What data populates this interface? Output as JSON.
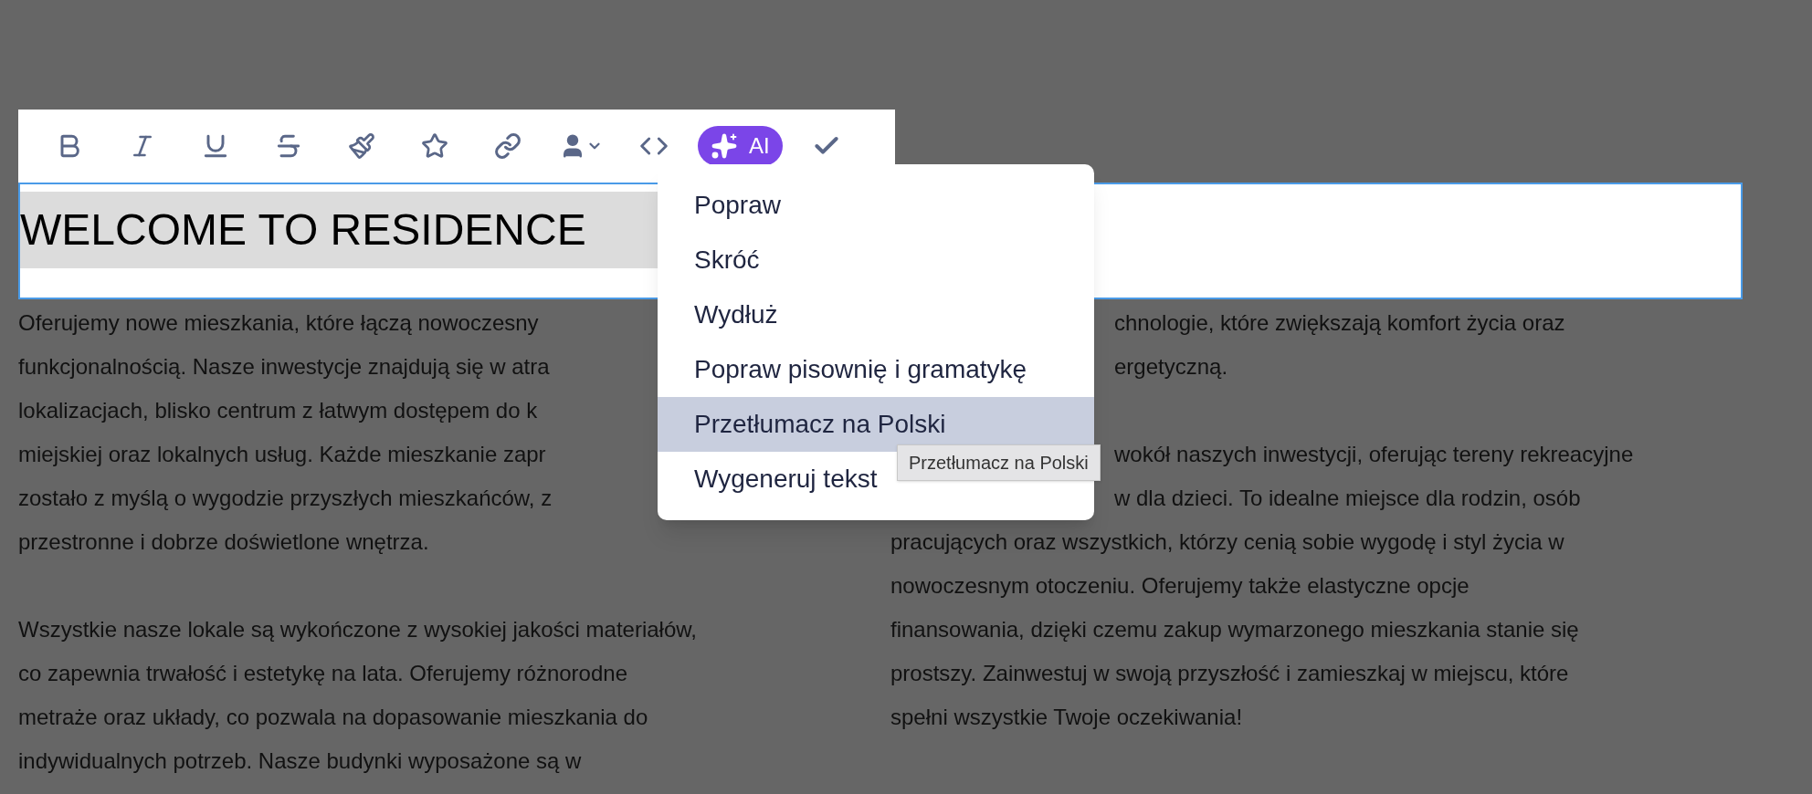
{
  "toolbar": {
    "ai_button": {
      "label": "AI"
    }
  },
  "heading": {
    "text": "WELCOME TO RESIDENCE",
    "highlighted": true
  },
  "left_column": {
    "paragraphs": [
      [
        "Oferujemy nowe mieszkania, które łączą nowoczesny",
        "funkcjonalnością. Nasze inwestycje znajdują się w atra",
        "lokalizacjach, blisko centrum z łatwym dostępem do k",
        "miejskiej oraz lokalnych usług. Każde mieszkanie zapr",
        "zostało z myślą o wygodzie przyszłych mieszkańców, z",
        "przestronne i dobrze doświetlone wnętrza."
      ],
      [
        "Wszystkie nasze lokale są wykończone z wysokiej jakości materiałów,",
        "co zapewnia trwałość i estetykę na lata. Oferujemy różnorodne",
        "metraże oraz układy, co pozwala na dopasowanie mieszkania do",
        "indywidualnych potrzeb. Nasze budynki wyposażone są w"
      ]
    ]
  },
  "right_column": {
    "paragraphs": [
      {
        "beside_menu": [
          "chnologie, które zwiększają komfort życia oraz",
          "ergetyczną."
        ]
      },
      {
        "beside_menu": [
          "wokół naszych inwestycji, oferując tereny rekreacyjne",
          "w dla dzieci. To idealne miejsce dla rodzin, osób"
        ],
        "lines": [
          "pracujących oraz wszystkich, którzy cenią sobie wygodę i styl życia w",
          "nowoczesnym otoczeniu. Oferujemy także elastyczne opcje",
          "finansowania, dzięki czemu zakup wymarzonego mieszkania stanie się",
          "prostszy. Zainwestuj w swoją przyszłość i zamieszkaj w miejscu, które",
          "spełni wszystkie Twoje oczekiwania!"
        ]
      }
    ]
  },
  "ai_menu": {
    "items": [
      {
        "label": "Popraw",
        "selected": false
      },
      {
        "label": "Skróć",
        "selected": false
      },
      {
        "label": "Wydłuż",
        "selected": false
      },
      {
        "label": "Popraw pisownię i gramatykę",
        "selected": false
      },
      {
        "label": "Przetłumacz na Polski",
        "selected": true
      },
      {
        "label": "Wygeneruj tekst",
        "selected": false
      }
    ]
  },
  "tooltip": {
    "text": "Przetłumacz na Polski"
  }
}
